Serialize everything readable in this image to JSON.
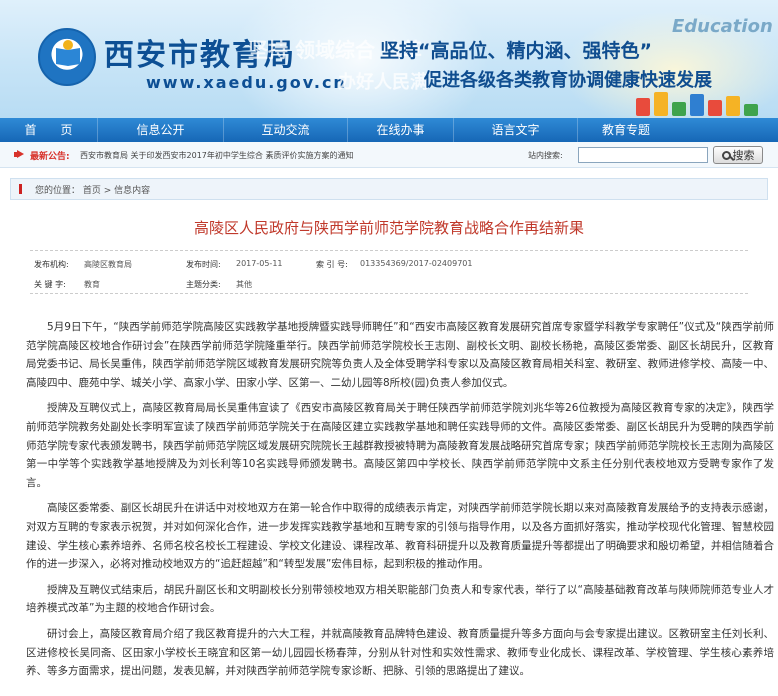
{
  "header": {
    "site_name": "西安市教育局",
    "site_url": "www.xaedu.gov.cn",
    "faded_line1": "坚持 领域综合 改革",
    "faded_line2": "办好人民满",
    "slogan_line1": "坚持“高品位、精内涵、强特色”",
    "slogan_line2": "促进各级各类教育协调健康快速发展",
    "edu_word": "Education"
  },
  "nav": {
    "items": [
      {
        "label": "首　　页"
      },
      {
        "label": "信息公开"
      },
      {
        "label": "互动交流"
      },
      {
        "label": "在线办事"
      },
      {
        "label": "语言文字"
      },
      {
        "label": "教育专题"
      }
    ]
  },
  "notice": {
    "label": "最新公告:",
    "text": "西安市教育局 关于印发西安市2017年初中学生综合 素质评价实施方案的通知",
    "search_label": "站内搜索:",
    "search_value": "",
    "search_button": "搜索"
  },
  "breadcrumb": {
    "text": "您的位置： 首页 > 信息内容"
  },
  "article": {
    "title": "高陵区人民政府与陕西学前师范学院教育战略合作再结新果",
    "meta": {
      "publisher_label": "发布机构:",
      "publisher": "高陵区教育局",
      "date_label": "发布时间:",
      "date": "2017-05-11",
      "index_label": "索 引 号:",
      "index": "013354369/2017-02409701",
      "keywords_label": "关 键 字:",
      "keywords": "教育",
      "topic_label": "主题分类:",
      "topic": "其他"
    },
    "paragraphs": [
      "5月9日下午，“陕西学前师范学院高陵区实践教学基地授牌暨实践导师聘任”和“西安市高陵区教育发展研究首席专家暨学科教学专家聘任”仪式及“陕西学前师范学院高陵区校地合作研讨会”在陕西学前师范学院隆重举行。陕西学前师范学院校长王志刚、副校长文明、副校长杨艳，高陵区委常委、副区长胡民升，区教育局党委书记、局长吴重伟，陕西学前师范学院区域教育发展研究院等负责人及全体受聘学科专家以及高陵区教育局相关科室、教研室、教师进修学校、高陵一中、高陵四中、鹿苑中学、城关小学、高家小学、田家小学、区第一、二幼儿园等8所校(园)负责人参加仪式。",
      "授牌及互聘仪式上，高陵区教育局局长吴重伟宣读了《西安市高陵区教育局关于聘任陕西学前师范学院刘兆华等26位教授为高陵区教育专家的决定》，陕西学前师范学院教务处副处长李明军宣读了陕西学前师范学院关于在高陵区建立实践教学基地和聘任实践导师的文件。高陵区委常委、副区长胡民升为受聘的陕西学前师范学院专家代表颁发聘书，陕西学前师范学院区域发展研究院院长王越群教授被特聘为高陵教育发展战略研究首席专家；陕西学前师范学院校长王志刚为高陵区第一中学等个实践教学基地授牌及为刘长利等10名实践导师颁发聘书。高陵区第四中学校长、陕西学前师范学院中文系主任分别代表校地双方受聘专家作了发言。",
      "高陵区委常委、副区长胡民升在讲话中对校地双方在第一轮合作中取得的成绩表示肯定，对陕西学前师范学院长期以来对高陵教育发展给予的支持表示感谢，对双方互聘的专家表示祝贺，并对如何深化合作，进一步发挥实践教学基地和互聘专家的引领与指导作用，以及各方面抓好落实，推动学校现代化管理、智慧校园建设、学生核心素养培养、名师名校名校长工程建设、学校文化建设、课程改革、教育科研提升以及教育质量提升等都提出了明确要求和殷切希望，并相信随着合作的进一步深入，必将对推动校地双方的“追赶超越”和“转型发展”宏伟目标，起到积极的推动作用。",
      "授牌及互聘仪式结束后，胡民升副区长和文明副校长分别带领校地双方相关职能部门负责人和专家代表，举行了以“高陵基础教育改革与陕师院师范专业人才培养模式改革”为主题的校地合作研讨会。",
      "研讨会上，高陵区教育局介绍了我区教育提升的六大工程，并就高陵教育品牌特色建设、教育质量提升等多方面向与会专家提出建议。区教研室主任刘长利、区进修校长吴同斋、区田家小学校长王晓宜和区第一幼儿园园长杨春萍，分别从针对性和实效性需求、教师专业化成长、课程改革、学校管理、学生核心素养培养、等多方面需求，提出问题，发表见解，并对陕西学前师范学院专家诊断、把脉、引领的思路提出了建议。"
    ]
  }
}
